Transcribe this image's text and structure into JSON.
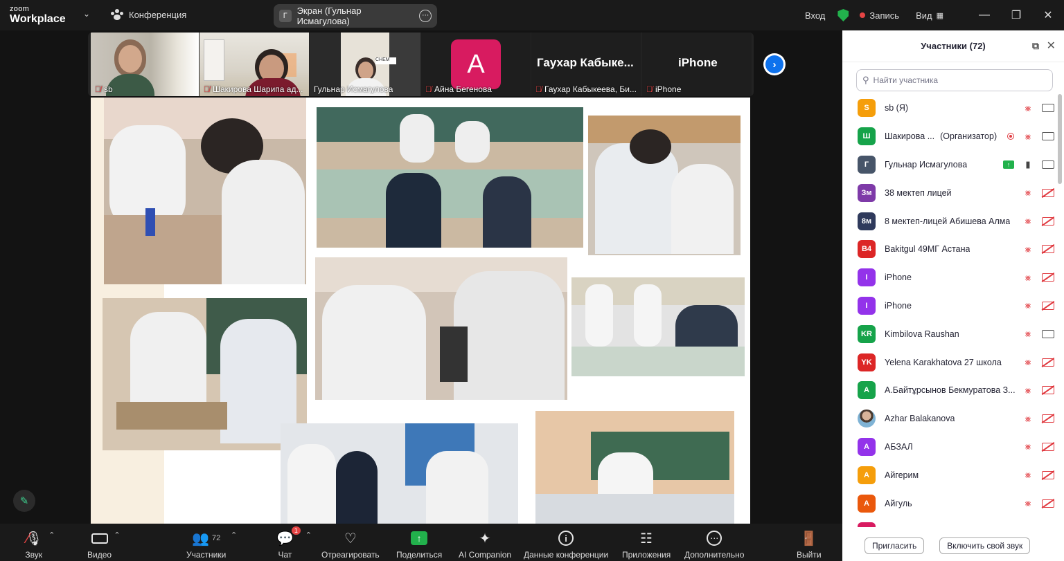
{
  "app": {
    "logo_line1": "zoom",
    "logo_line2": "Workplace",
    "meeting_label": "Конференция"
  },
  "share_pill": {
    "badge": "Г",
    "label": "Экран (Гульнар Исмагулова)"
  },
  "top_right": {
    "signin": "Вход",
    "record": "Запись",
    "view": "Вид"
  },
  "video_strip": {
    "tiles": [
      {
        "name": "sb"
      },
      {
        "name": "Шакирова Шарипа ад..."
      },
      {
        "name": "Гульнар Исмагулова"
      },
      {
        "name": "Айна Бегенова",
        "avatar_letter": "A",
        "avatar_color": "#d81b60"
      },
      {
        "name": "Гаухар Кабыкеева, Би...",
        "display": "Гаухар  Кабыке..."
      },
      {
        "name": "iPhone",
        "display": "iPhone"
      }
    ]
  },
  "toolbar": {
    "audio": "Звук",
    "video": "Видео",
    "participants": "Участники",
    "participants_count": "72",
    "chat": "Чат",
    "chat_badge": "1",
    "react": "Отреагировать",
    "share": "Поделиться",
    "ai": "AI Companion",
    "info": "Данные конференции",
    "apps": "Приложения",
    "more": "Дополнительно",
    "leave": "Выйти"
  },
  "panel": {
    "title": "Участники (72)",
    "search_placeholder": "Найти участника",
    "invite": "Пригласить",
    "unmute_me": "Включить свой звук",
    "participants": [
      {
        "initials": "S",
        "color": "#f59e0b",
        "name": "sb (Я)",
        "role": "",
        "mic": "off",
        "cam": "on"
      },
      {
        "initials": "Ш",
        "color": "#16a34a",
        "name": "Шакирова ...",
        "role": "(Организатор)",
        "mic": "off",
        "cam": "on",
        "rec": true
      },
      {
        "initials": "Г",
        "color": "#475569",
        "name": "Гульнар Исмагулова",
        "role": "",
        "mic": "on",
        "cam": "on",
        "share": true
      },
      {
        "initials": "Зм",
        "color": "#7e3aa8",
        "name": "38 мектеп лицей",
        "role": "",
        "mic": "off",
        "cam": "off"
      },
      {
        "initials": "8м",
        "color": "#2f3a5c",
        "name": "8 мектеп-лицей Абишева Алма",
        "role": "",
        "mic": "off",
        "cam": "off"
      },
      {
        "initials": "B4",
        "color": "#dc2626",
        "name": "Bakitgul 49МГ Астана",
        "role": "",
        "mic": "off",
        "cam": "off"
      },
      {
        "initials": "I",
        "color": "#9333ea",
        "name": "iPhone",
        "role": "",
        "mic": "off",
        "cam": "off"
      },
      {
        "initials": "I",
        "color": "#9333ea",
        "name": "iPhone",
        "role": "",
        "mic": "off",
        "cam": "off"
      },
      {
        "initials": "KR",
        "color": "#16a34a",
        "name": "Kimbilova Raushan",
        "role": "",
        "mic": "off",
        "cam": "on"
      },
      {
        "initials": "YK",
        "color": "#dc2626",
        "name": "Yelena Karakhatova 27 школа",
        "role": "",
        "mic": "off",
        "cam": "off"
      },
      {
        "initials": "A",
        "color": "#16a34a",
        "name": "А.Байтұрсынов  Бекмуратова З...",
        "role": "",
        "mic": "off",
        "cam": "off"
      },
      {
        "initials": "",
        "color": "#7c8aa5",
        "name": "Azhar Balakanova",
        "role": "",
        "mic": "off",
        "cam": "off",
        "photo": true
      },
      {
        "initials": "A",
        "color": "#9333ea",
        "name": "АБЗАЛ",
        "role": "",
        "mic": "off",
        "cam": "off"
      },
      {
        "initials": "A",
        "color": "#f59e0b",
        "name": "Айгерим",
        "role": "",
        "mic": "off",
        "cam": "off"
      },
      {
        "initials": "A",
        "color": "#ea580c",
        "name": "Айгуль",
        "role": "",
        "mic": "off",
        "cam": "off"
      }
    ]
  }
}
